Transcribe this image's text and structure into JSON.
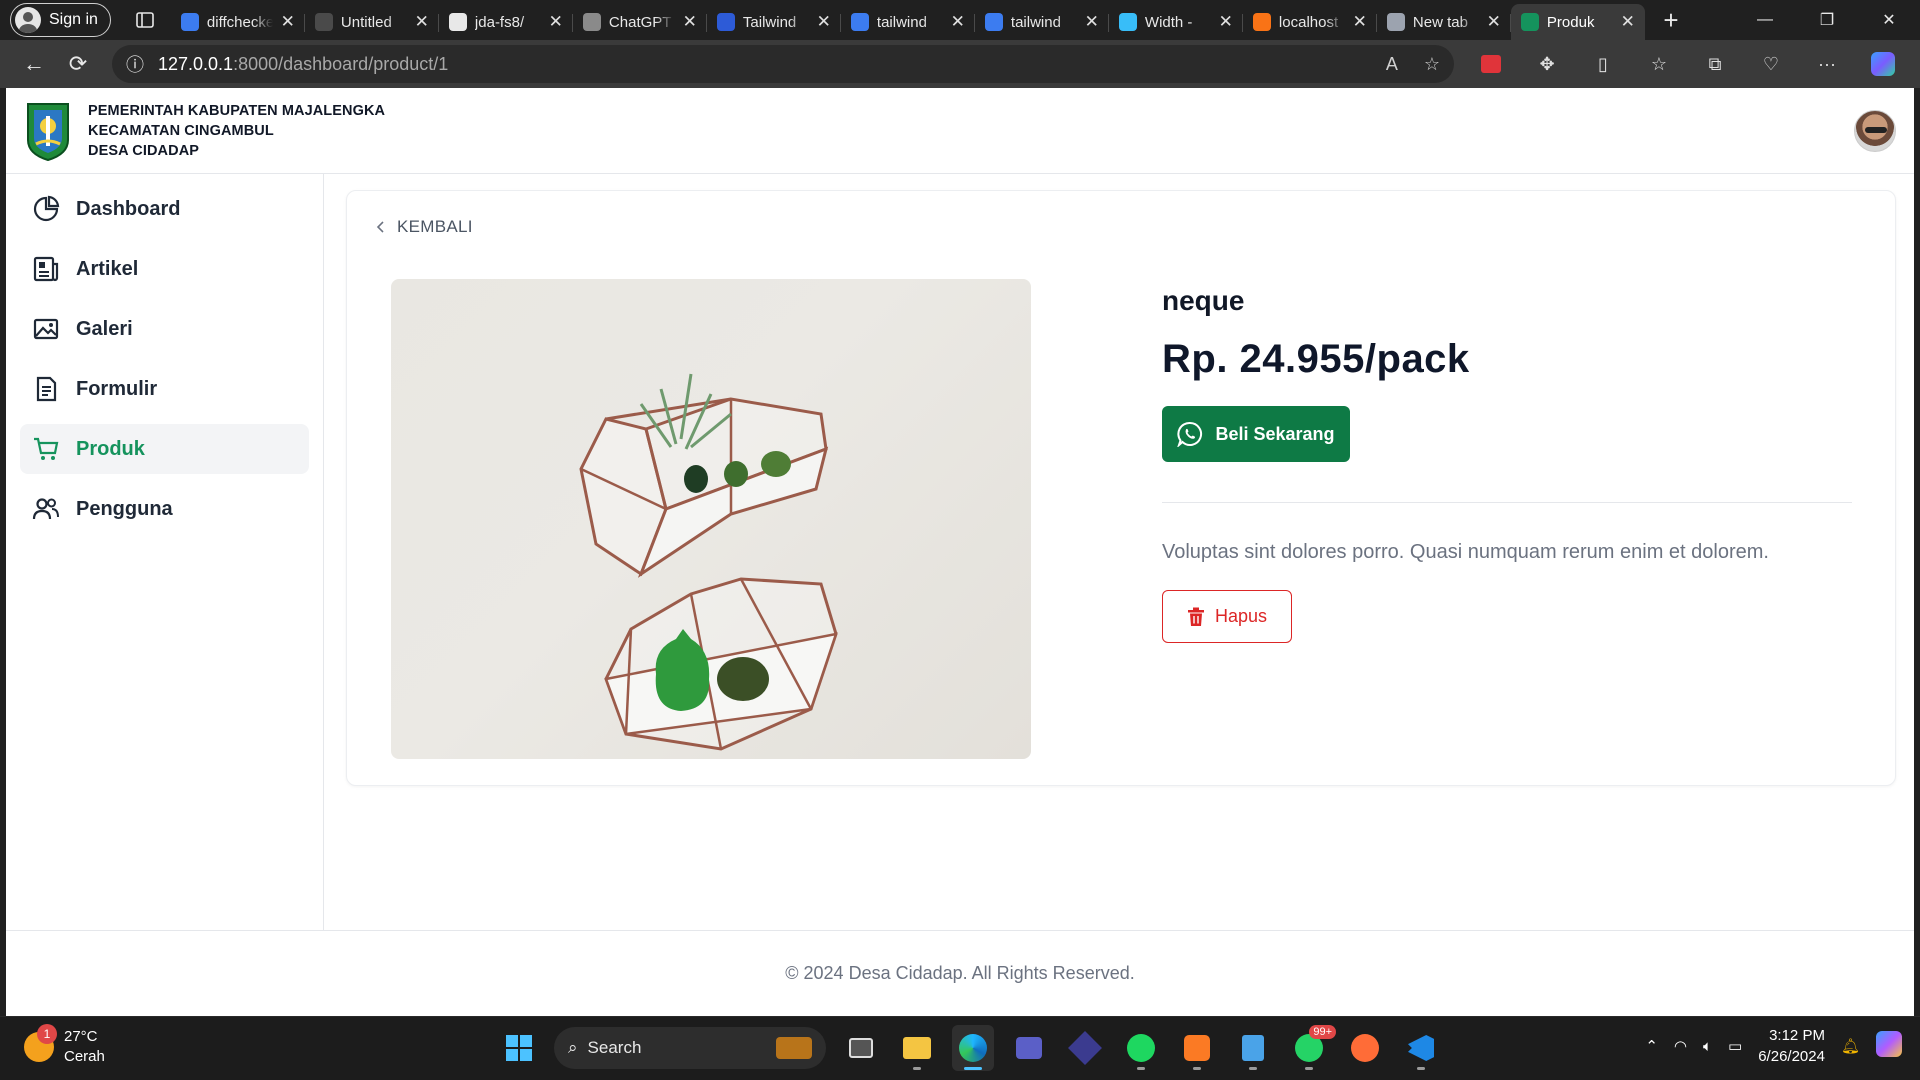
{
  "browser": {
    "signin_label": "Sign in",
    "tabs": [
      {
        "title": "diffchecker",
        "icon": "search-icon",
        "color": "#3c7cf0"
      },
      {
        "title": "Untitled",
        "icon": "doc-icon",
        "color": "#4a4a4a"
      },
      {
        "title": "jda-fs8/",
        "icon": "github-icon",
        "color": "#e8e8e8"
      },
      {
        "title": "ChatGPT",
        "icon": "chatgpt-icon",
        "color": "#8a8a8a"
      },
      {
        "title": "Tailwind",
        "icon": "tailwind-icon",
        "color": "#2d5bd7"
      },
      {
        "title": "tailwind",
        "icon": "search-icon",
        "color": "#3c7cf0"
      },
      {
        "title": "tailwind",
        "icon": "search-icon",
        "color": "#3c7cf0"
      },
      {
        "title": "Width -",
        "icon": "tailwind-icon",
        "color": "#38bdf8"
      },
      {
        "title": "localhost",
        "icon": "xampp-icon",
        "color": "#f97316"
      },
      {
        "title": "New tab",
        "icon": "newtab-icon",
        "color": "#9ca3af"
      },
      {
        "title": "Produk",
        "icon": "logo-icon",
        "color": "#15935d"
      }
    ],
    "url_host": "127.0.0.1",
    "url_path": ":8000/dashboard/product/1"
  },
  "header": {
    "line1": "PEMERINTAH KABUPATEN MAJALENGKA",
    "line2": "KECAMATAN CINGAMBUL",
    "line3": "DESA CIDADAP"
  },
  "sidebar": {
    "items": [
      {
        "label": "Dashboard",
        "icon": "pie-chart-icon"
      },
      {
        "label": "Artikel",
        "icon": "newspaper-icon"
      },
      {
        "label": "Galeri",
        "icon": "image-icon"
      },
      {
        "label": "Formulir",
        "icon": "form-icon"
      },
      {
        "label": "Produk",
        "icon": "cart-icon",
        "active": true
      },
      {
        "label": "Pengguna",
        "icon": "users-icon"
      }
    ]
  },
  "product": {
    "back_label": "KEMBALI",
    "name": "neque",
    "price": "Rp. 24.955/pack",
    "buy_label": "Beli Sekarang",
    "description": "Voluptas sint dolores porro. Quasi numquam rerum enim et dolorem.",
    "delete_label": "Hapus"
  },
  "footer": {
    "text": "© 2024 Desa Cidadap. All Rights Reserved."
  },
  "taskbar": {
    "weather_temp": "27°C",
    "weather_desc": "Cerah",
    "weather_badge": "1",
    "search_label": "Search",
    "whatsapp_badge": "99+",
    "time": "3:12 PM",
    "date": "6/26/2024"
  },
  "colors": {
    "accent": "#15935d",
    "buy_button": "#0e7a45",
    "danger": "#dc2626"
  }
}
